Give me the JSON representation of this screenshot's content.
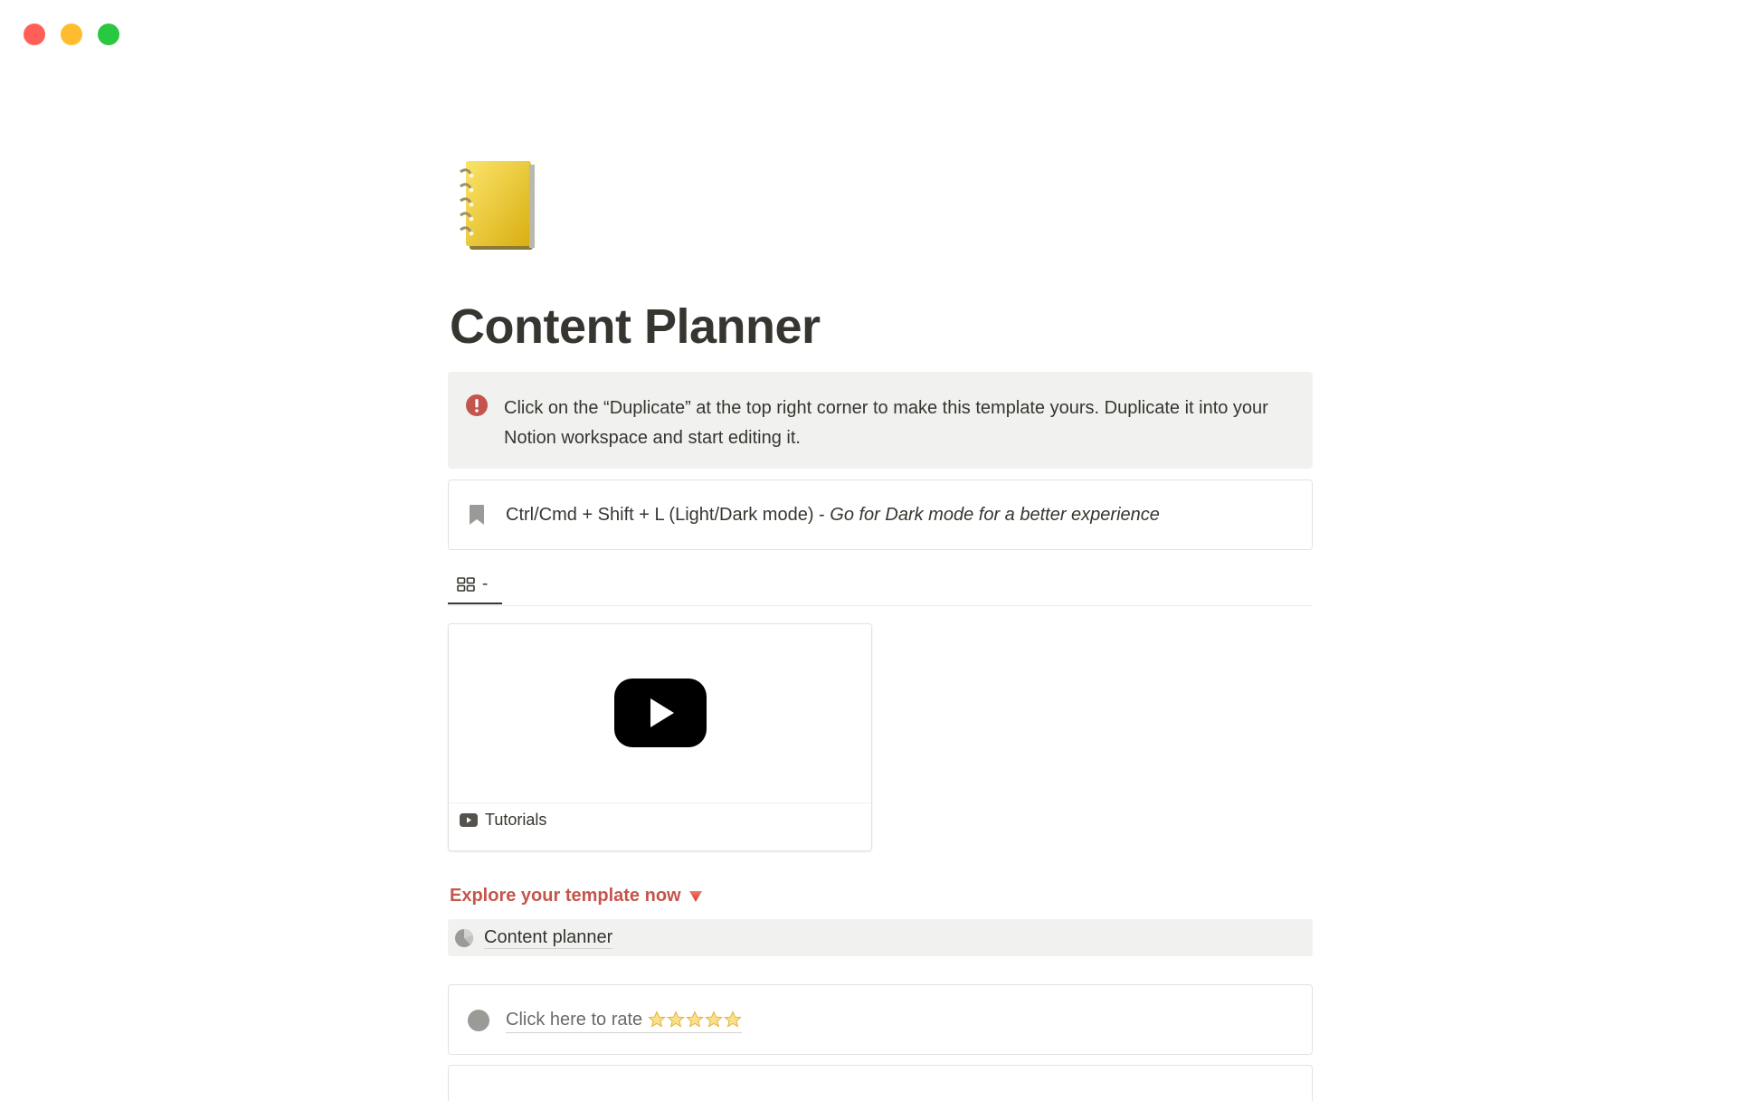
{
  "window": {
    "controls": [
      "close",
      "minimize",
      "maximize"
    ]
  },
  "page": {
    "icon": "spiral-notebook-icon",
    "title": "Content Planner"
  },
  "callout_warning": {
    "icon": "exclamation-icon",
    "text": "Click on the “Duplicate” at the top right corner to make this template yours. Duplicate it into your Notion workspace and start editing it."
  },
  "callout_bookmark": {
    "icon": "bookmark-icon",
    "text_plain": "Ctrl/Cmd + Shift + L (Light/Dark mode) - ",
    "text_italic": "Go for Dark mode for a better experience"
  },
  "view_tabs": [
    {
      "icon": "gallery-icon",
      "label": "-"
    }
  ],
  "gallery": {
    "cards": [
      {
        "cover_icon": "youtube-play-icon",
        "icon": "youtube-icon",
        "title": "Tutorials"
      }
    ]
  },
  "explore": {
    "heading": "Explore your template now",
    "icon": "down-triangle-icon"
  },
  "page_link": {
    "icon": "pie-chart-icon",
    "label": "Content planner"
  },
  "rate": {
    "icon": "circle-icon",
    "label": "Click here to rate",
    "stars": 5
  },
  "colors": {
    "text": "#37352f",
    "callout_bg": "#f1f1ef",
    "accent_red": "#c4554d",
    "border": "#e3e2e0"
  }
}
